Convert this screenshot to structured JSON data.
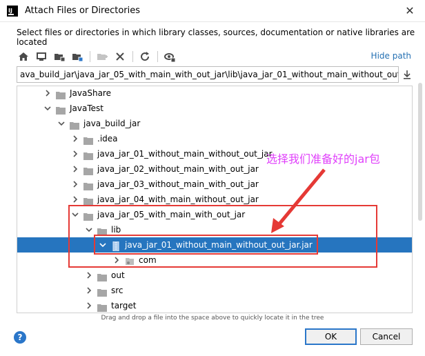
{
  "window": {
    "title": "Attach Files or Directories",
    "app_icon_text": "IJ",
    "close_glyph": "✕"
  },
  "description": "Select files or directories in which library classes, sources, documentation or native libraries are located",
  "toolbar": {
    "icons": [
      "home-icon",
      "desktop-icon",
      "project-folder-icon",
      "module-folder-icon",
      "new-folder-icon",
      "delete-icon",
      "refresh-icon",
      "show-hidden-icon"
    ],
    "hide_path_label": "Hide path"
  },
  "path": {
    "value": "ava_build_jar\\java_jar_05_with_main_with_out_jar\\lib\\java_jar_01_without_main_without_out_jar.jar"
  },
  "tree": {
    "rows": [
      {
        "label": "JavaShare",
        "depth": 0,
        "expanded": false,
        "icon": "folder"
      },
      {
        "label": "JavaTest",
        "depth": 0,
        "expanded": true,
        "icon": "folder"
      },
      {
        "label": "java_build_jar",
        "depth": 1,
        "expanded": true,
        "icon": "folder"
      },
      {
        "label": ".idea",
        "depth": 2,
        "expanded": false,
        "icon": "folder"
      },
      {
        "label": "java_jar_01_without_main_without_out_jar",
        "depth": 2,
        "expanded": false,
        "icon": "folder"
      },
      {
        "label": "java_jar_02_without_main_with_out_jar",
        "depth": 2,
        "expanded": false,
        "icon": "folder"
      },
      {
        "label": "java_jar_03_without_main_with_out_jar",
        "depth": 2,
        "expanded": false,
        "icon": "folder"
      },
      {
        "label": "java_jar_04_with_main_without_out_jar",
        "depth": 2,
        "expanded": false,
        "icon": "folder"
      },
      {
        "label": "java_jar_05_with_main_with_out_jar",
        "depth": 2,
        "expanded": true,
        "icon": "folder"
      },
      {
        "label": "lib",
        "depth": 3,
        "expanded": true,
        "icon": "folder"
      },
      {
        "label": "java_jar_01_without_main_without_out_jar.jar",
        "depth": 4,
        "expanded": true,
        "icon": "jar",
        "selected": true
      },
      {
        "label": "com",
        "depth": 5,
        "expanded": false,
        "icon": "package"
      },
      {
        "label": "out",
        "depth": 3,
        "expanded": false,
        "icon": "folder"
      },
      {
        "label": "src",
        "depth": 3,
        "expanded": false,
        "icon": "folder"
      },
      {
        "label": "target",
        "depth": 3,
        "expanded": false,
        "icon": "folder"
      }
    ]
  },
  "drag_hint": "Drag and drop a file into the space above to quickly locate it in the tree",
  "buttons": {
    "help": "?",
    "ok": "OK",
    "cancel": "Cancel"
  },
  "annotation": {
    "text": "选择我们准备好的jar包",
    "color": "#e040fb",
    "box_color": "#e53935"
  },
  "colors": {
    "selection": "#2675bf",
    "link": "#2470b3",
    "folder": "#9e9e9e"
  }
}
